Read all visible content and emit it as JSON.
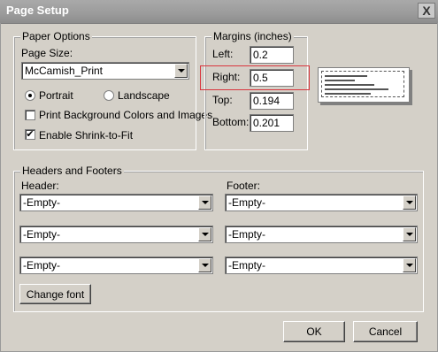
{
  "window": {
    "title": "Page Setup",
    "close_glyph": "X"
  },
  "paper_options": {
    "legend": "Paper Options",
    "page_size_label": "Page Size:",
    "page_size_value": "McCamish_Print",
    "portrait_label": "Portrait",
    "landscape_label": "Landscape",
    "orientation_selected": "Portrait",
    "print_background_label": "Print Background Colors and Images",
    "print_background_checked": false,
    "shrink_to_fit_label": "Enable Shrink-to-Fit",
    "shrink_to_fit_checked": true
  },
  "margins": {
    "legend": "Margins (inches)",
    "left_label": "Left:",
    "left_value": "0.2",
    "right_label": "Right:",
    "right_value": "0.5",
    "top_label": "Top:",
    "top_value": "0.194",
    "bottom_label": "Bottom:",
    "bottom_value": "0.201",
    "highlight_color": "#d9363e"
  },
  "headers_footers": {
    "legend": "Headers and Footers",
    "header_label": "Header:",
    "footer_label": "Footer:",
    "header_values": [
      "-Empty-",
      "-Empty-",
      "-Empty-"
    ],
    "footer_values": [
      "-Empty-",
      "-Empty-",
      "-Empty-"
    ],
    "change_font_label": "Change font"
  },
  "buttons": {
    "ok": "OK",
    "cancel": "Cancel"
  },
  "icons": {
    "dropdown": "chevron-down-icon",
    "close": "close-icon",
    "check": "checkmark-icon"
  }
}
